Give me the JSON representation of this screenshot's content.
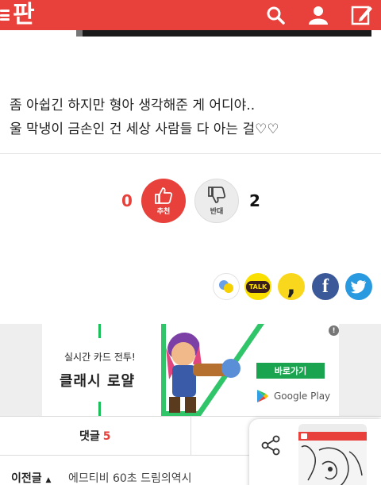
{
  "header": {
    "logo_text": "판",
    "brand_color": "#e8403a",
    "icons": [
      "menu-icon",
      "search-icon",
      "user-icon",
      "write-icon"
    ]
  },
  "post": {
    "lines": [
      "좀 아쉽긴 하지만 형아 생각해준 게 어디야..",
      "울 막냉이 금손인 건 세상 사람들 다 아는 걸♡♡"
    ]
  },
  "vote": {
    "up_count": "0",
    "up_label": "추천",
    "down_label": "반대",
    "down_count": "2"
  },
  "share": {
    "talk_label": "TALK",
    "comma_label": ",",
    "facebook_label": "f",
    "icons": [
      "kakaostory-icon",
      "kakaotalk-icon",
      "band-icon",
      "facebook-icon",
      "twitter-icon"
    ]
  },
  "ad": {
    "subtitle": "실시간 카드 전투!",
    "title": "클래시 로얄",
    "cta_label": "바로가기",
    "store_label": "Google Play",
    "info_label": "!"
  },
  "comments": {
    "label": "댓글",
    "count": "5"
  },
  "prev_post": {
    "label": "이전글",
    "arrow": "▲",
    "title": "에므티비 60초 드림의역시"
  }
}
